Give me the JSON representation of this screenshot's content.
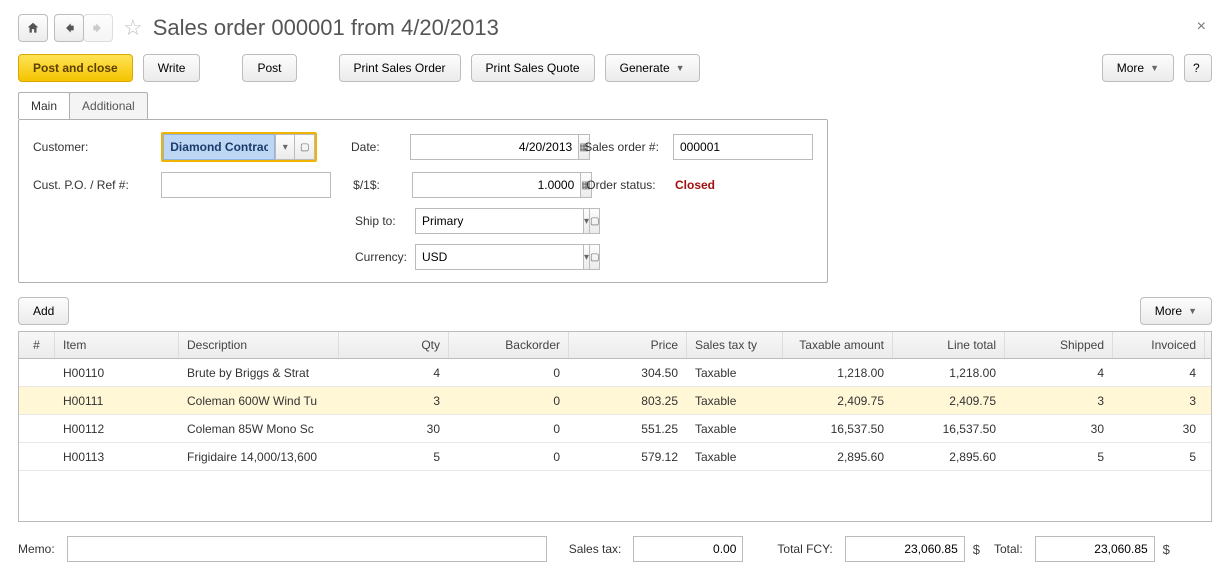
{
  "header": {
    "title": "Sales order 000001 from 4/20/2013"
  },
  "toolbar": {
    "post_and_close": "Post and close",
    "write": "Write",
    "post": "Post",
    "print_order": "Print Sales Order",
    "print_quote": "Print Sales Quote",
    "generate": "Generate",
    "more": "More",
    "help": "?"
  },
  "tabs": {
    "main": "Main",
    "additional": "Additional"
  },
  "form": {
    "labels": {
      "customer": "Customer:",
      "date": "Date:",
      "sales_order_no": "Sales order #:",
      "cust_po": "Cust. P.O. / Ref #:",
      "rate": "$/1$:",
      "order_status": "Order status:",
      "ship_to": "Ship to:",
      "currency": "Currency:"
    },
    "values": {
      "customer": "Diamond Contract",
      "date": "4/20/2013",
      "sales_order_no": "000001",
      "cust_po": "",
      "rate": "1.0000",
      "order_status": "Closed",
      "ship_to": "Primary",
      "currency": "USD"
    }
  },
  "lineitems_bar": {
    "add": "Add",
    "more": "More"
  },
  "grid": {
    "headers": {
      "num": "#",
      "item": "Item",
      "description": "Description",
      "qty": "Qty",
      "backorder": "Backorder",
      "price": "Price",
      "sales_tax": "Sales tax ty",
      "taxable_amount": "Taxable amount",
      "line_total": "Line total",
      "shipped": "Shipped",
      "invoiced": "Invoiced"
    },
    "rows": [
      {
        "item": "H00110",
        "description": "Brute by Briggs & Strat",
        "qty": "4",
        "backorder": "0",
        "price": "304.50",
        "sales_tax": "Taxable",
        "taxable_amount": "1,218.00",
        "line_total": "1,218.00",
        "shipped": "4",
        "invoiced": "4",
        "selected": false
      },
      {
        "item": "H00111",
        "description": "Coleman 600W Wind Tu",
        "qty": "3",
        "backorder": "0",
        "price": "803.25",
        "sales_tax": "Taxable",
        "taxable_amount": "2,409.75",
        "line_total": "2,409.75",
        "shipped": "3",
        "invoiced": "3",
        "selected": true
      },
      {
        "item": "H00112",
        "description": "Coleman 85W Mono Sc",
        "qty": "30",
        "backorder": "0",
        "price": "551.25",
        "sales_tax": "Taxable",
        "taxable_amount": "16,537.50",
        "line_total": "16,537.50",
        "shipped": "30",
        "invoiced": "30",
        "selected": false
      },
      {
        "item": "H00113",
        "description": "Frigidaire 14,000/13,600",
        "qty": "5",
        "backorder": "0",
        "price": "579.12",
        "sales_tax": "Taxable",
        "taxable_amount": "2,895.60",
        "line_total": "2,895.60",
        "shipped": "5",
        "invoiced": "5",
        "selected": false
      }
    ]
  },
  "footer": {
    "labels": {
      "memo": "Memo:",
      "sales_tax": "Sales tax:",
      "total_fcy": "Total FCY:",
      "total": "Total:"
    },
    "values": {
      "memo": "",
      "sales_tax": "0.00",
      "total_fcy": "23,060.85",
      "total": "23,060.85"
    },
    "currency_symbols": {
      "fcy": "$",
      "total": "$"
    }
  }
}
